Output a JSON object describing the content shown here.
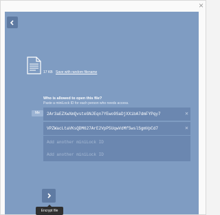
{
  "window": {
    "close_label": "×"
  },
  "file": {
    "icon": "document-icon",
    "size": "17 KB",
    "save_link": "Save with random filename"
  },
  "recipients": {
    "title": "Who is allowed to open this file?",
    "subtitle": "Paste a miniLock ID for each person who needs access.",
    "me_label": "Me",
    "ids": [
      "2Ar3aEZXwXmQvsteGNJEqn7YEwo9SaDjXXibA7dmFYPqy7",
      "VPZWacLtaVKsQDM627ArE2VpP5UqwVdMf5wslSgmVpCd7"
    ],
    "placeholders": [
      "Add another miniLock ID",
      "Add another miniLock ID"
    ],
    "remove_glyph": "✕"
  },
  "actions": {
    "encrypt_tooltip": "Encrypt file"
  },
  "colors": {
    "panel": "#7f9cc2",
    "row": "#6b87b0",
    "button": "#5f7ba3",
    "tooltip": "#2f2f2f"
  }
}
